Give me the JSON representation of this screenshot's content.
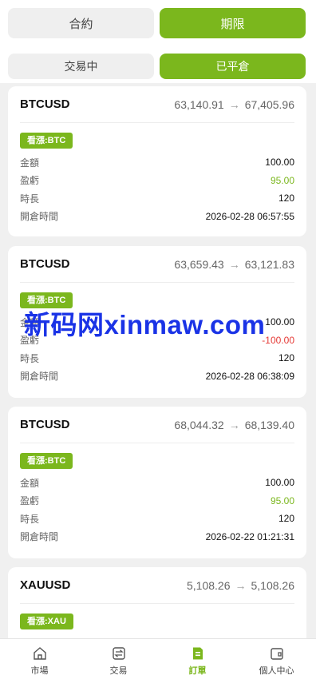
{
  "tabs": {
    "main": [
      {
        "label": "合約"
      },
      {
        "label": "期限"
      }
    ],
    "sub": [
      {
        "label": "交易中"
      },
      {
        "label": "已平倉"
      }
    ]
  },
  "orders": [
    {
      "symbol": "BTCUSD",
      "open_price": "63,140.91",
      "close_price": "67,405.96",
      "arrow": "→",
      "direction": "看漲:BTC",
      "rows": [
        {
          "label": "金額",
          "value": "100.00"
        },
        {
          "label": "盈虧",
          "value": "95.00"
        },
        {
          "label": "時長",
          "value": "120"
        },
        {
          "label": "開倉時間",
          "value": "2026-02-28 06:57:55"
        }
      ]
    },
    {
      "symbol": "BTCUSD",
      "open_price": "63,659.43",
      "close_price": "63,121.83",
      "arrow": "→",
      "direction": "看漲:BTC",
      "rows": [
        {
          "label": "金額",
          "value": "100.00"
        },
        {
          "label": "盈虧",
          "value": "-100.00"
        },
        {
          "label": "時長",
          "value": "120"
        },
        {
          "label": "開倉時間",
          "value": "2026-02-28 06:38:09"
        }
      ]
    },
    {
      "symbol": "BTCUSD",
      "open_price": "68,044.32",
      "close_price": "68,139.40",
      "arrow": "→",
      "direction": "看漲:BTC",
      "rows": [
        {
          "label": "金額",
          "value": "100.00"
        },
        {
          "label": "盈虧",
          "value": "95.00"
        },
        {
          "label": "時長",
          "value": "120"
        },
        {
          "label": "開倉時間",
          "value": "2026-02-22 01:21:31"
        }
      ]
    },
    {
      "symbol": "XAUUSD",
      "open_price": "5,108.26",
      "close_price": "5,108.26",
      "arrow": "→",
      "direction": "看漲:XAU",
      "rows": []
    }
  ],
  "watermark": "新码网xinmaw.com",
  "nav": [
    {
      "label": "市場",
      "icon": "home-icon"
    },
    {
      "label": "交易",
      "icon": "trade-icon"
    },
    {
      "label": "訂單",
      "icon": "order-icon"
    },
    {
      "label": "個人中心",
      "icon": "wallet-icon"
    }
  ],
  "colors": {
    "accent": "#7bb71d",
    "negative": "#e53935",
    "watermark": "#1a33e6"
  }
}
